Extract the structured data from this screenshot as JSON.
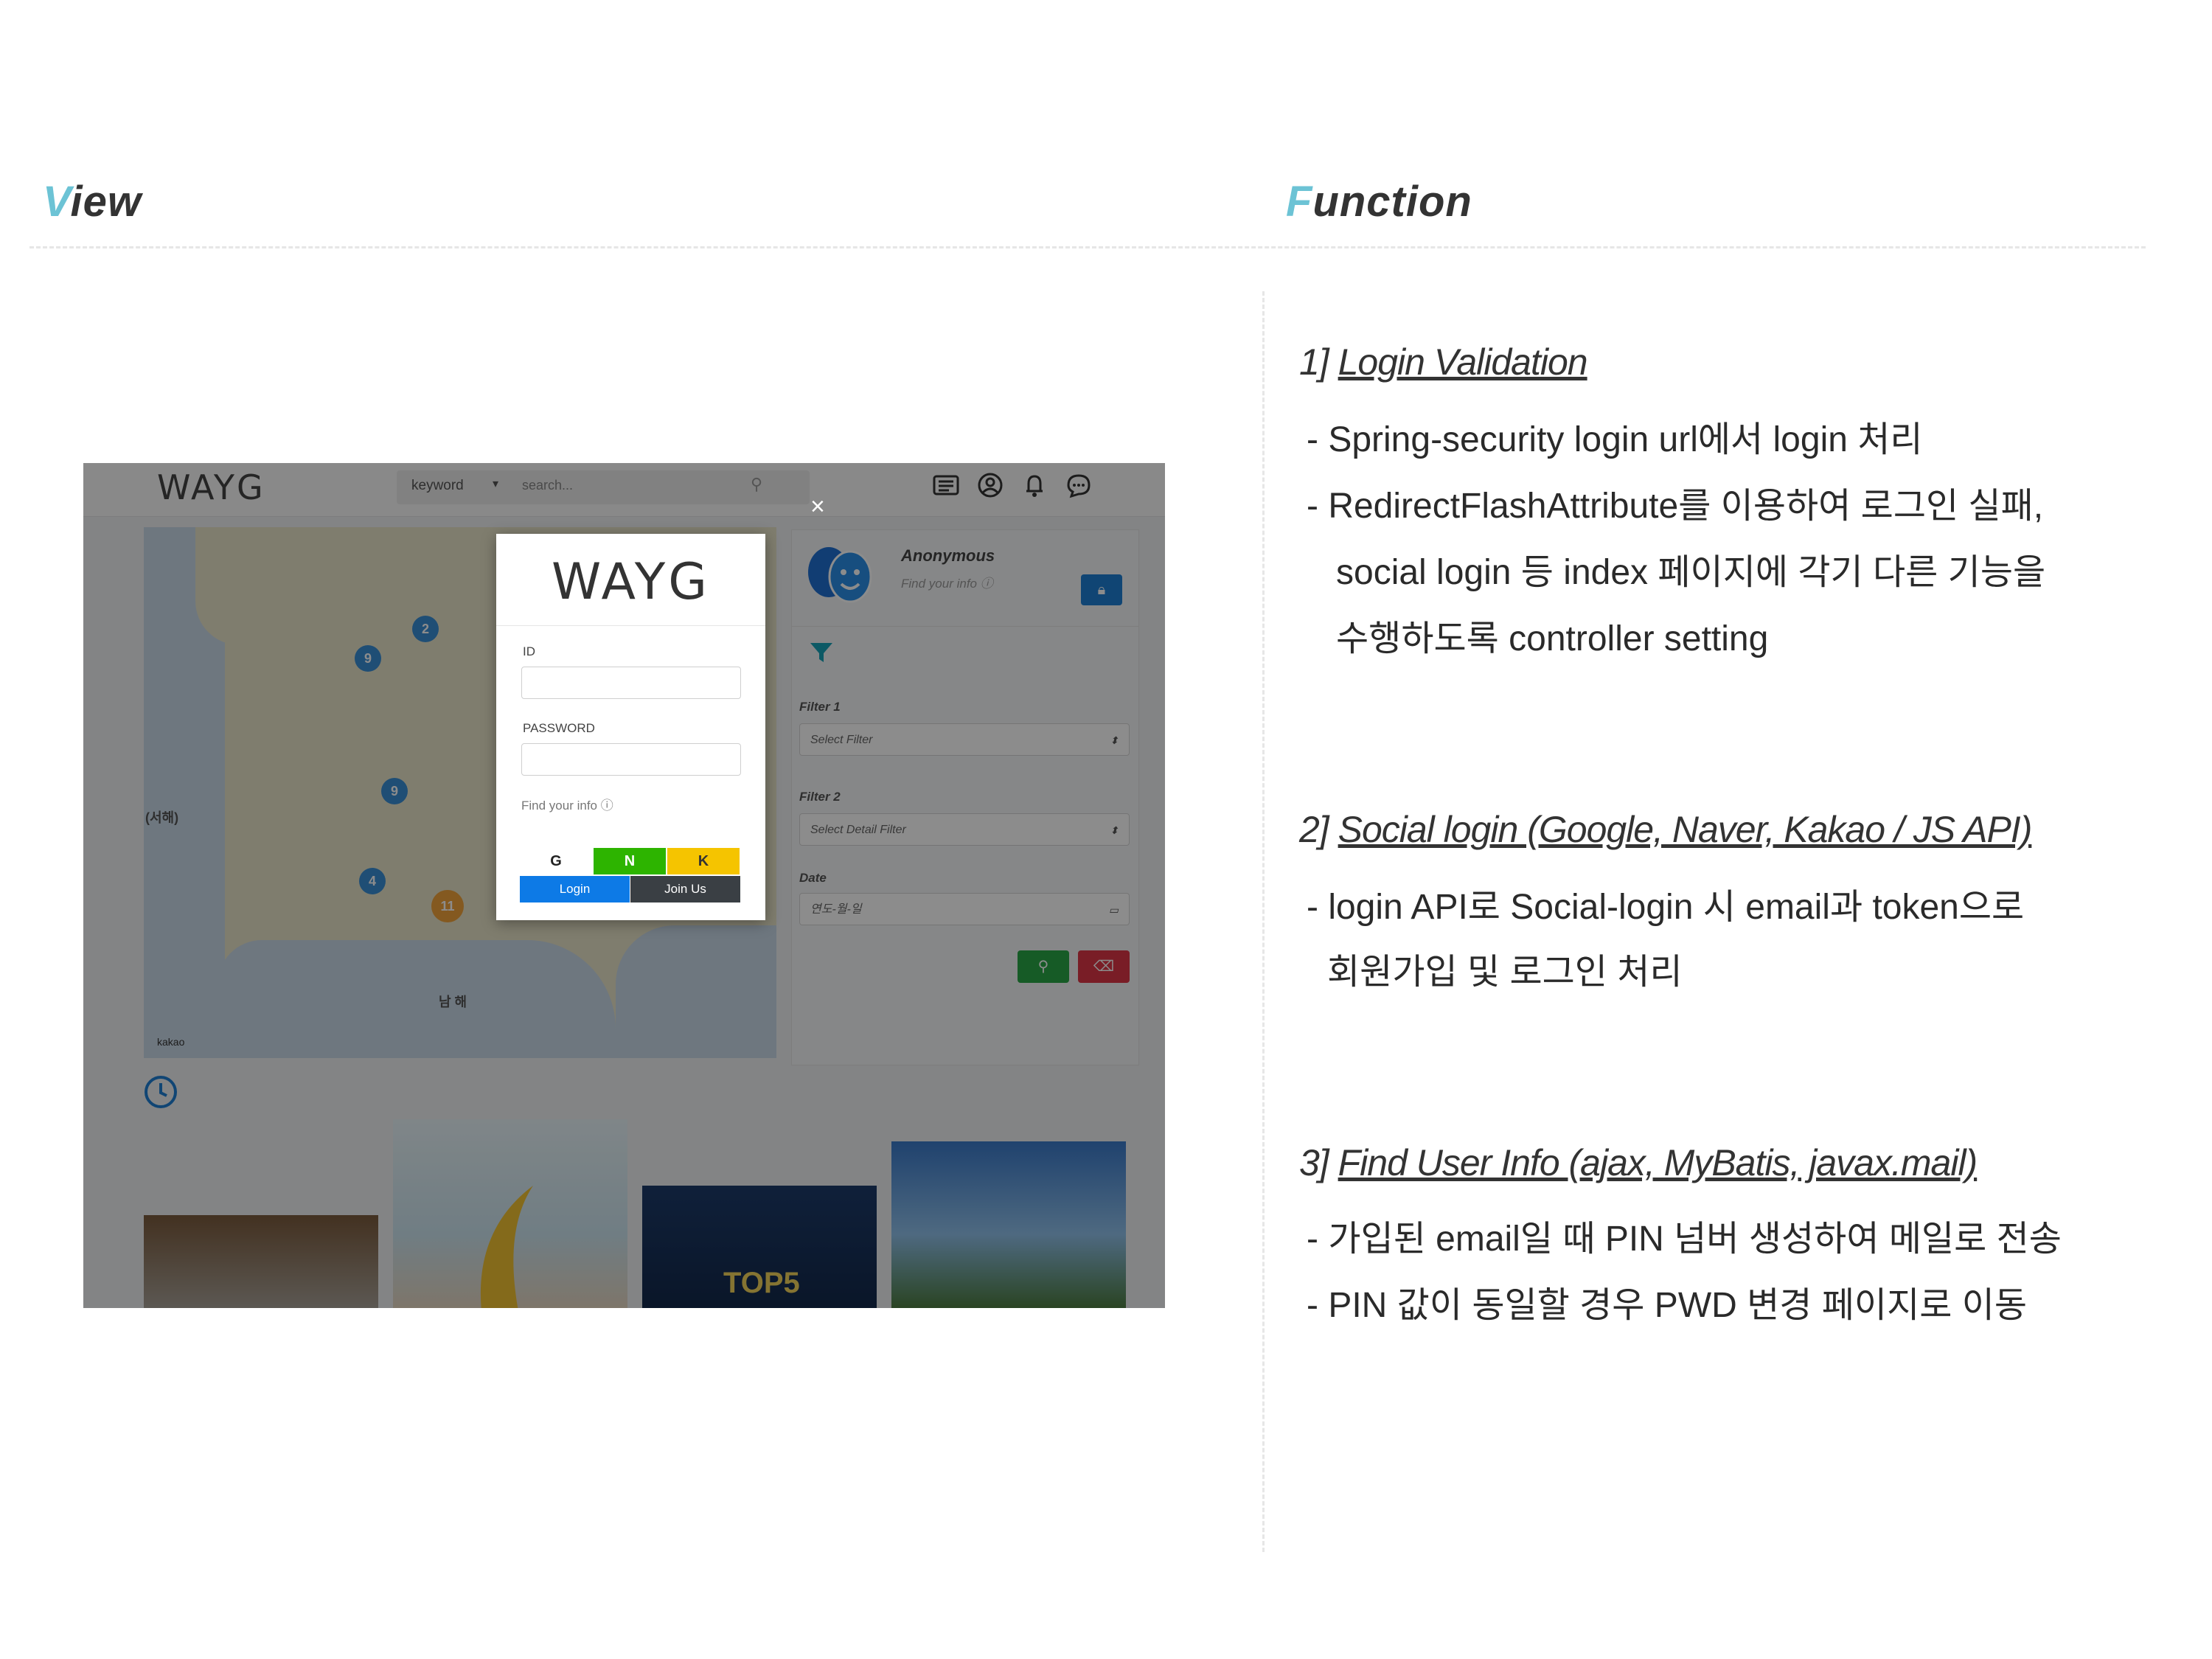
{
  "headings": {
    "view_first": "V",
    "view_rest": "iew",
    "function_first": "F",
    "function_rest": "unction"
  },
  "screenshot": {
    "app_logo": "WAYG",
    "search": {
      "keyword_label": "keyword",
      "placeholder": "search..."
    },
    "map": {
      "markers": [
        {
          "label": "2",
          "color": "blue"
        },
        {
          "label": "9",
          "color": "blue"
        },
        {
          "label": "9",
          "color": "blue"
        },
        {
          "label": "4",
          "color": "blue"
        },
        {
          "label": "11",
          "color": "orange"
        }
      ],
      "region_left": "(서해)",
      "region_bottom": "남 해",
      "kakao_label": "kakao"
    },
    "profile": {
      "name": "Anonymous",
      "subtitle": "Find your info ⓘ"
    },
    "filters": {
      "filter1_label": "Filter 1",
      "filter1_value": "Select Filter",
      "filter2_label": "Filter 2",
      "filter2_value": "Select Detail Filter",
      "date_label": "Date",
      "date_value": "연도-월-일"
    },
    "login_modal": {
      "logo": "WAYG",
      "id_label": "ID",
      "password_label": "PASSWORD",
      "find_info": "Find your info ⓘ",
      "google": "G",
      "naver": "N",
      "kakao": "K",
      "login": "Login",
      "join": "Join Us",
      "close": "×"
    },
    "thumbnails": [
      {
        "caption": ""
      },
      {
        "caption": ""
      },
      {
        "caption": "TOP5"
      },
      {
        "caption": ""
      }
    ]
  },
  "functions": [
    {
      "num": "1]",
      "title": "Login Validation",
      "lines": [
        "- Spring-security login url에서 login 처리",
        "- RedirectFlashAttribute를 이용하여 로그인 실패,",
        "social login 등 index 페이지에 각기 다른 기능을",
        "수행하도록 controller setting"
      ]
    },
    {
      "num": "2]",
      "title": "Social login (Google, Naver, Kakao / JS API)",
      "lines": [
        "- login API로 Social-login 시 email과 token으로",
        "회원가입 및 로그인 처리"
      ]
    },
    {
      "num": "3]",
      "title": "Find User Info (ajax, MyBatis, javax.mail)",
      "lines": [
        "- 가입된 email일 때 PIN 넘버 생성하여 메일로 전송",
        "- PIN 값이 동일할 경우 PWD 변경 페이지로 이동"
      ]
    }
  ],
  "colors": {
    "accent": "#6cc3d5",
    "google": "#ffffff",
    "naver": "#2db400",
    "kakao": "#f5c400",
    "login": "#0d7ae6"
  }
}
